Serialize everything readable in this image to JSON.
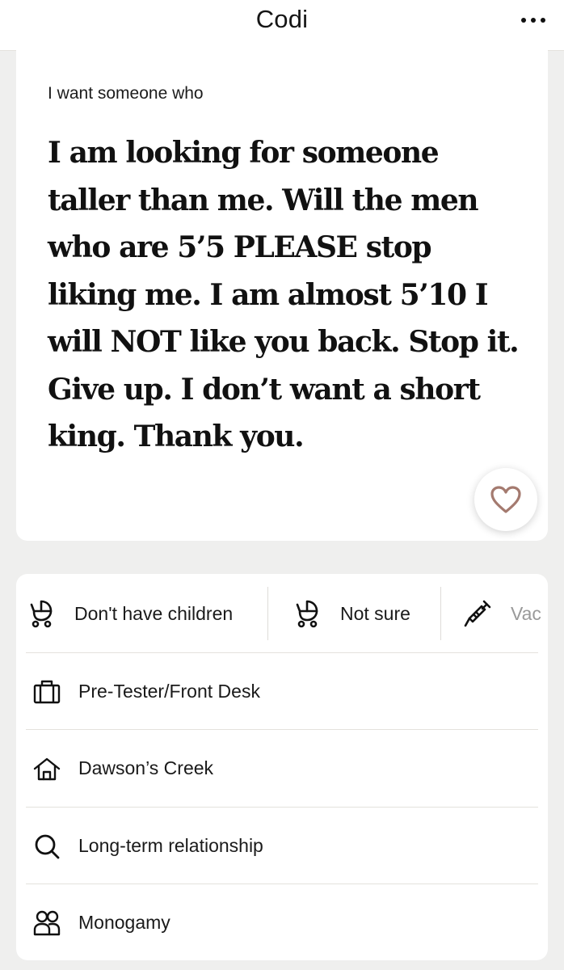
{
  "header": {
    "title": "Codi",
    "more_icon": "more-horizontal-icon"
  },
  "prompt": {
    "label": "I want someone who",
    "answer_lines": [
      "I am looking for someone",
      "taller than me. Will the men",
      "who are 5’5 PLEASE stop",
      "liking me. I am almost 5’10 I",
      "will NOT like you back. Stop it.",
      "Give up. I don’t want a short",
      "king. Thank you."
    ],
    "like_icon": "heart-icon"
  },
  "vitals": {
    "chips": [
      {
        "icon": "baby-stroller-icon",
        "label": "Don't have children"
      },
      {
        "icon": "baby-stroller-icon",
        "label": "Not sure"
      },
      {
        "icon": "syringe-icon",
        "label": "Vac"
      }
    ],
    "rows": [
      {
        "icon": "briefcase-icon",
        "label": "Pre-Tester/Front Desk"
      },
      {
        "icon": "home-icon",
        "label": "Dawson’s Creek"
      },
      {
        "icon": "search-icon",
        "label": "Long-term relationship"
      },
      {
        "icon": "people-icon",
        "label": "Monogamy"
      }
    ]
  },
  "colors": {
    "background": "#efefee",
    "card": "#ffffff",
    "heart_accent": "#a47a6f",
    "divider": "#e4e2dd"
  }
}
